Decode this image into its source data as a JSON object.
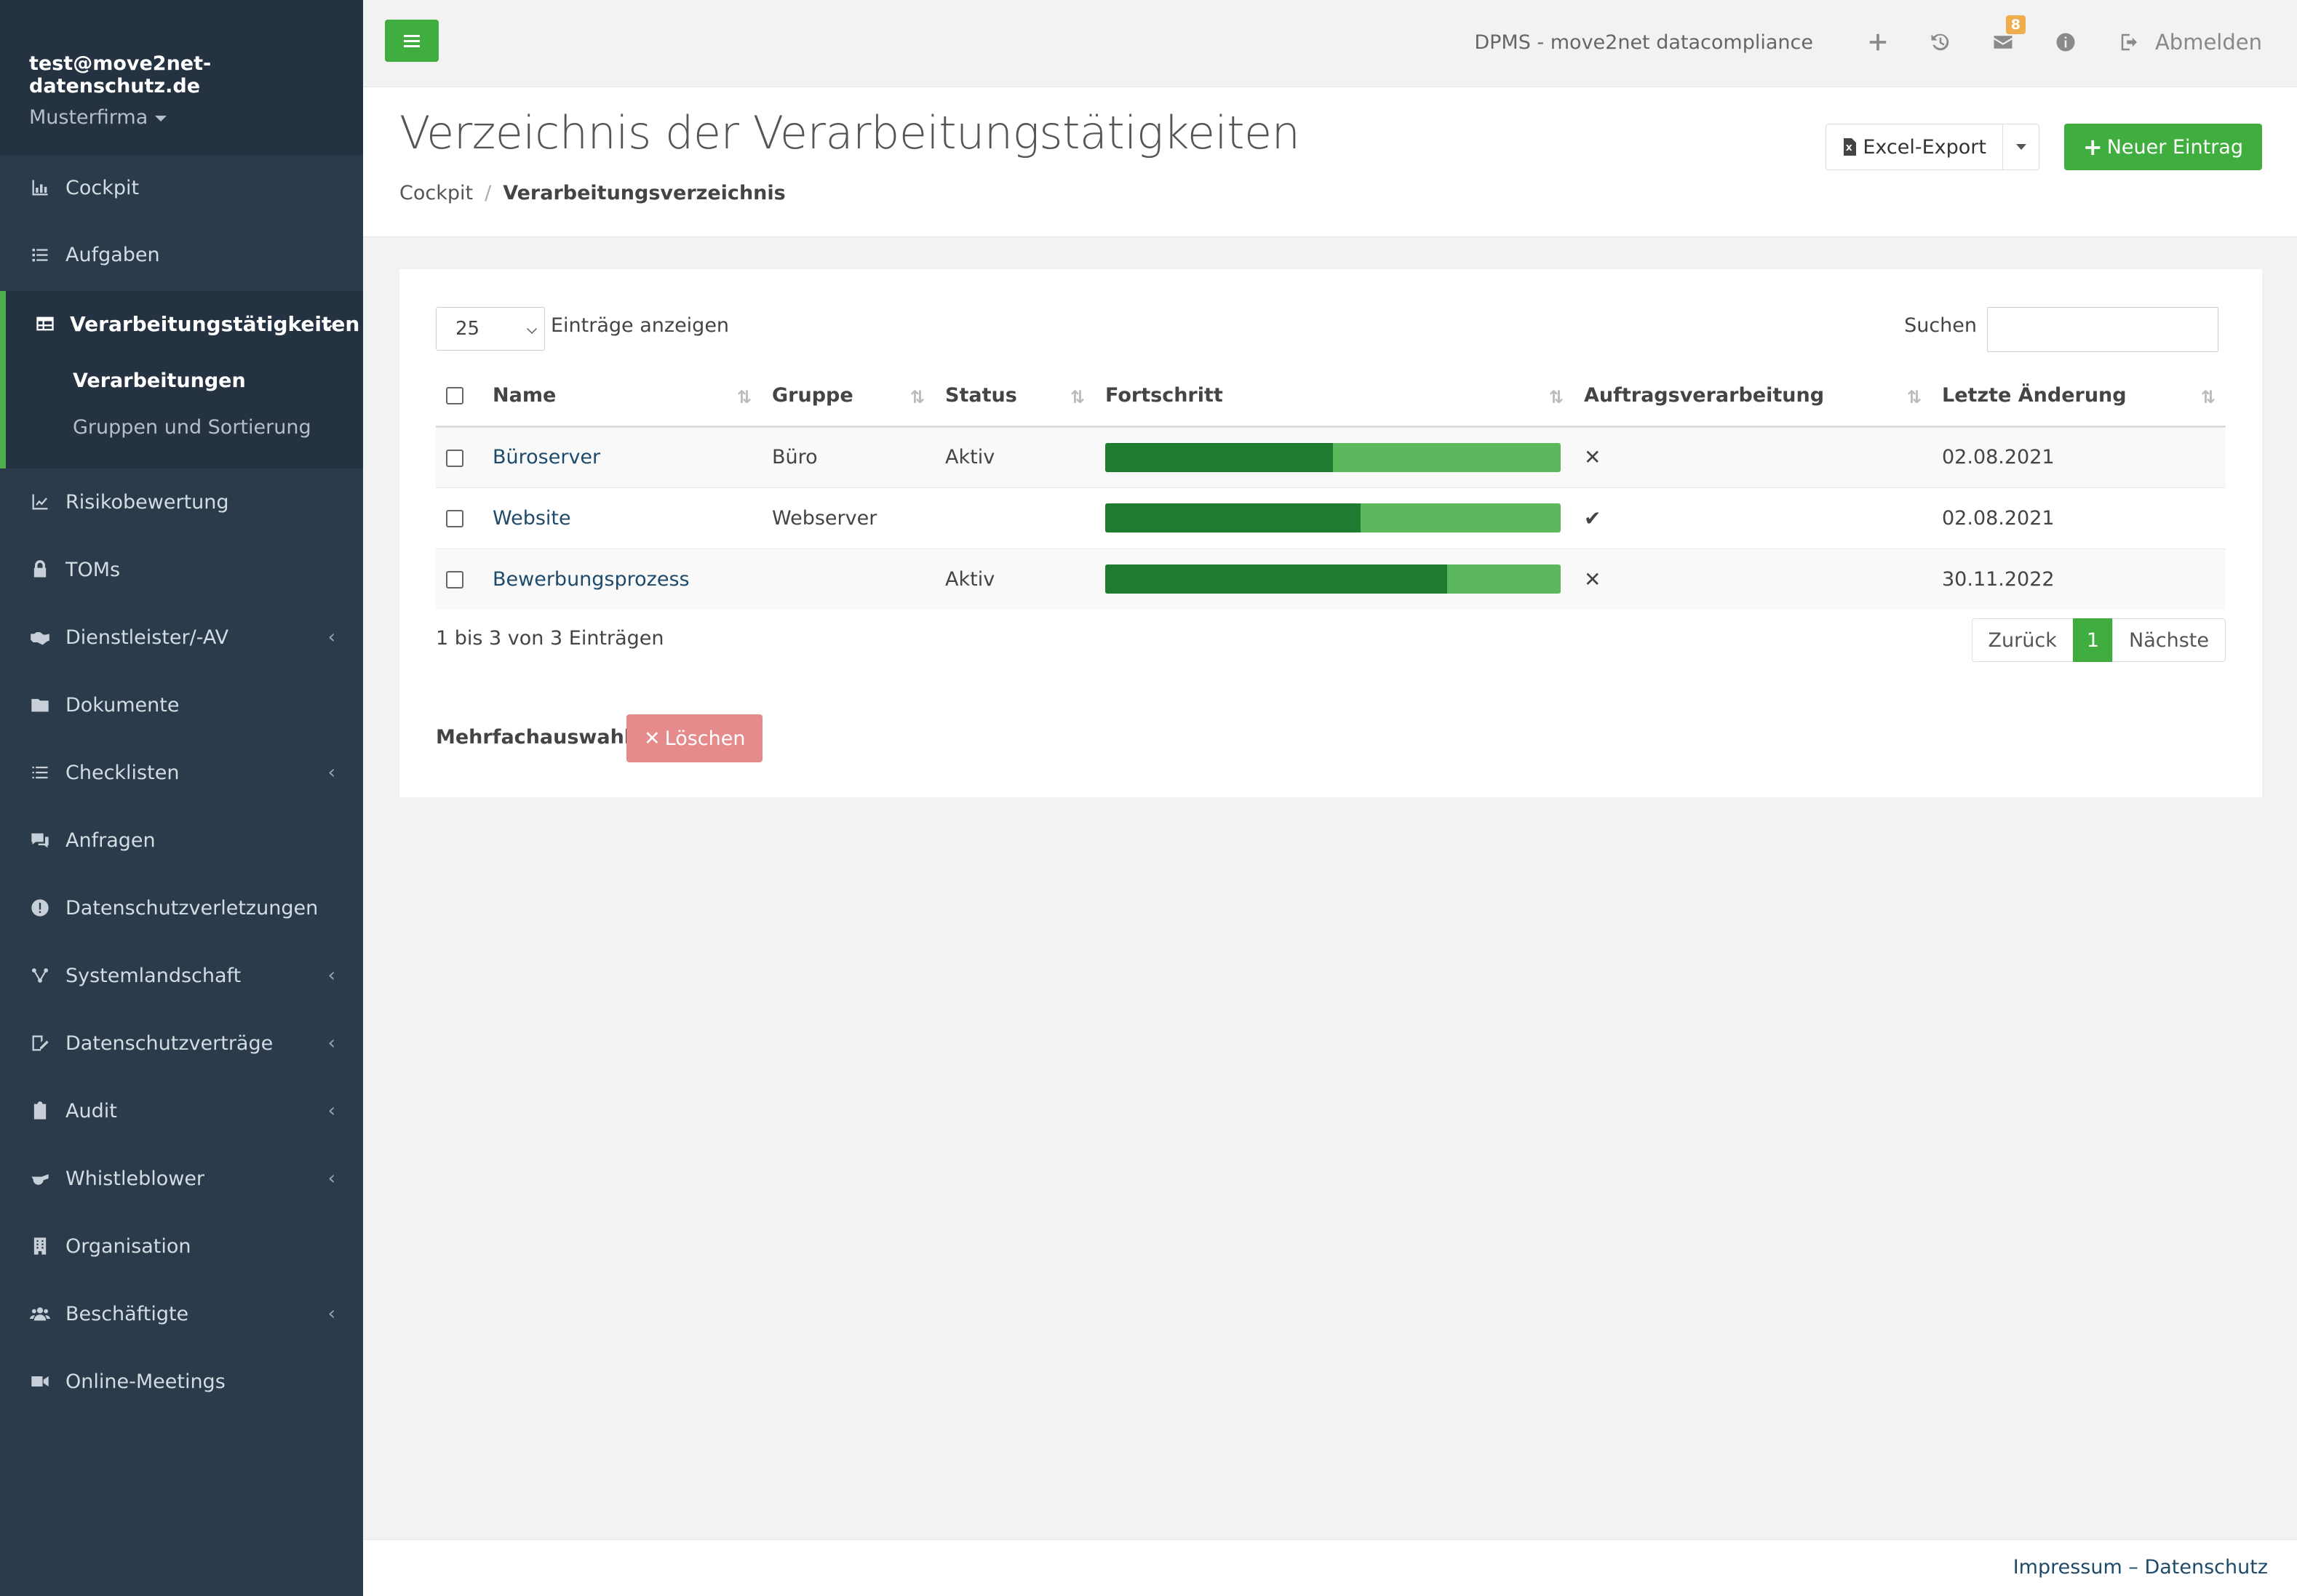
{
  "user": {
    "email": "test@move2net-datenschutz.de",
    "company": "Musterfirma"
  },
  "sidebar": {
    "items": [
      {
        "label": "Cockpit",
        "icon": "chart-bar-icon"
      },
      {
        "label": "Aufgaben",
        "icon": "tasks-icon"
      },
      {
        "label": "Verarbeitungstätigkeiten",
        "icon": "table-icon",
        "active": true,
        "children": [
          {
            "label": "Verarbeitungen",
            "active": true
          },
          {
            "label": "Gruppen und Sortierung"
          }
        ]
      },
      {
        "label": "Risikobewertung",
        "icon": "chart-line-icon"
      },
      {
        "label": "TOMs",
        "icon": "lock-icon"
      },
      {
        "label": "Dienstleister/-AV",
        "icon": "handshake-icon",
        "expandable": true
      },
      {
        "label": "Dokumente",
        "icon": "folder-icon"
      },
      {
        "label": "Checklisten",
        "icon": "list-icon",
        "expandable": true
      },
      {
        "label": "Anfragen",
        "icon": "comments-icon"
      },
      {
        "label": "Datenschutzverletzungen",
        "icon": "exclamation-circle-icon"
      },
      {
        "label": "Systemlandschaft",
        "icon": "network-icon",
        "expandable": true
      },
      {
        "label": "Datenschutzverträge",
        "icon": "signature-icon",
        "expandable": true
      },
      {
        "label": "Audit",
        "icon": "clipboard-icon",
        "expandable": true
      },
      {
        "label": "Whistleblower",
        "icon": "whistle-icon",
        "expandable": true
      },
      {
        "label": "Organisation",
        "icon": "building-icon"
      },
      {
        "label": "Beschäftigte",
        "icon": "users-icon",
        "expandable": true
      },
      {
        "label": "Online-Meetings",
        "icon": "video-icon"
      }
    ]
  },
  "topbar": {
    "app_title": "DPMS - move2net datacompliance",
    "notification_count": "8",
    "logout_label": "Abmelden"
  },
  "page": {
    "title": "Verzeichnis der Verarbeitungstätigkeiten",
    "breadcrumb": [
      "Cockpit",
      "Verarbeitungsverzeichnis"
    ]
  },
  "actions": {
    "excel_label": "Excel-Export",
    "new_label": "Neuer Eintrag"
  },
  "table_controls": {
    "page_length": "25",
    "length_label": "Einträge anzeigen",
    "search_label": "Suchen",
    "search_value": ""
  },
  "table": {
    "columns": [
      "Name",
      "Gruppe",
      "Status",
      "Fortschritt",
      "Auftragsverarbeitung",
      "Letzte Änderung"
    ],
    "rows": [
      {
        "name": "Büroserver",
        "group": "Büro",
        "status": "Aktiv",
        "progress": 0.5,
        "av": "✕",
        "date": "02.08.2021"
      },
      {
        "name": "Website",
        "group": "Webserver",
        "status": "",
        "progress": 0.56,
        "av": "✔",
        "date": "02.08.2021"
      },
      {
        "name": "Bewerbungsprozess",
        "group": "",
        "status": "Aktiv",
        "progress": 0.75,
        "av": "✕",
        "date": "30.11.2022"
      }
    ],
    "info": "1 bis 3 von 3 Einträgen"
  },
  "pagination": {
    "prev": "Zurück",
    "current": "1",
    "next": "Nächste"
  },
  "multi": {
    "label": "Mehrfachauswahl:",
    "delete_label": "Löschen"
  },
  "footer": {
    "links": "Impressum – Datenschutz"
  },
  "colors": {
    "accent": "#3fae3f",
    "sidebar": "#2c3b4b",
    "progress_dark": "#1e7b30",
    "progress_light": "#5cb85c",
    "danger": "#e58b8b"
  }
}
